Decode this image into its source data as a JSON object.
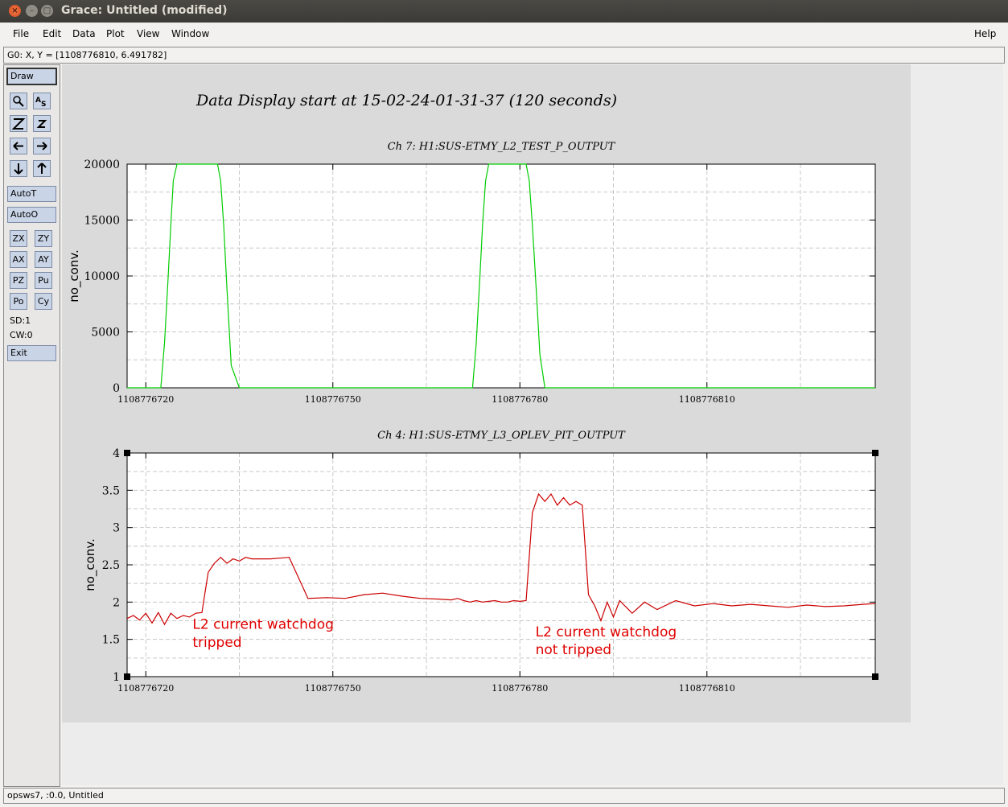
{
  "window": {
    "title": "Grace: Untitled (modified)",
    "close_glyph": "×",
    "min_glyph": "–",
    "max_glyph": "□"
  },
  "menu": {
    "file": "File",
    "edit": "Edit",
    "data": "Data",
    "plot": "Plot",
    "view": "View",
    "window": "Window",
    "help": "Help"
  },
  "locator": "G0: X, Y = [1108776810, 6.491782]",
  "toolbar": {
    "draw": "Draw",
    "autot": "AutoT",
    "autoo": "AutoO",
    "zx": "ZX",
    "zy": "ZY",
    "ax": "AX",
    "ay": "AY",
    "pz": "PZ",
    "pu": "Pu",
    "po": "Po",
    "cy": "Cy",
    "sd": "SD:1",
    "cw": "CW:0",
    "exit": "Exit",
    "icons": [
      "zoom-icon",
      "autoscale-text-icon",
      "zoom-in-icon",
      "zoom-out-icon",
      "left-arrow-icon",
      "right-arrow-icon",
      "down-arrow-icon",
      "up-arrow-icon"
    ]
  },
  "status": "opsws7, :0.0, Untitled",
  "canvas": {
    "main_title": "Data Display start at 15-02-24-01-31-37 (120 seconds)"
  },
  "chart_data": [
    {
      "type": "line",
      "title": "Ch 7: H1:SUS-ETMY_L2_TEST_P_OUTPUT",
      "ylabel": "no_conv.",
      "xlabel": "",
      "xlim": [
        1108776717,
        1108776837
      ],
      "ylim": [
        0,
        20000
      ],
      "xticks": [
        "1108776720",
        "1108776750",
        "1108776780",
        "1108776810"
      ],
      "yticks": [
        "0",
        "5000",
        "10000",
        "15000",
        "20000"
      ],
      "grid": true,
      "series": [
        {
          "color": "#00cc00",
          "x": [
            1108776717,
            1108776722.4,
            1108776723,
            1108776723.6,
            1108776724,
            1108776724.4,
            1108776725,
            1108776731.5,
            1108776732,
            1108776732.5,
            1108776733,
            1108776733.7,
            1108776735,
            1108776767,
            1108776772.4,
            1108776773,
            1108776773.6,
            1108776774,
            1108776774.5,
            1108776775,
            1108776781,
            1108776781.5,
            1108776782,
            1108776782.6,
            1108776783.2,
            1108776784,
            1108776837
          ],
          "y": [
            0,
            0,
            4000,
            10000,
            14500,
            18500,
            20000,
            20000,
            18500,
            14500,
            9000,
            2000,
            0,
            0,
            0,
            4000,
            10000,
            14500,
            18500,
            20000,
            20000,
            18500,
            14500,
            9000,
            3000,
            0,
            0
          ]
        }
      ]
    },
    {
      "type": "line",
      "title": "Ch 4: H1:SUS-ETMY_L3_OPLEV_PIT_OUTPUT",
      "ylabel": "no_conv.",
      "xlabel": "",
      "xlim": [
        1108776717,
        1108776837
      ],
      "ylim": [
        1,
        4
      ],
      "xticks": [
        "1108776720",
        "1108776750",
        "1108776780",
        "1108776810"
      ],
      "yticks": [
        "1",
        "1.5",
        "2",
        "2.5",
        "3",
        "3.5",
        "4"
      ],
      "grid": true,
      "annotations": [
        {
          "text": "L2 current watchdog",
          "x": 1108776727.5,
          "y": 1.64
        },
        {
          "text": "tripped",
          "x": 1108776727.5,
          "y": 1.4
        },
        {
          "text": "L2 current watchdog",
          "x": 1108776782.5,
          "y": 1.54
        },
        {
          "text": "not tripped",
          "x": 1108776782.5,
          "y": 1.3
        }
      ],
      "series": [
        {
          "color": "#cc0000",
          "x": [
            1108776717,
            1108776718,
            1108776719,
            1108776720,
            1108776721,
            1108776722,
            1108776723,
            1108776724,
            1108776725,
            1108776726,
            1108776727,
            1108776728,
            1108776729,
            1108776730,
            1108776731,
            1108776732,
            1108776733,
            1108776734,
            1108776735,
            1108776736,
            1108776737,
            1108776740,
            1108776743,
            1108776746,
            1108776749,
            1108776752,
            1108776755,
            1108776758,
            1108776761,
            1108776764,
            1108776767,
            1108776769,
            1108776770,
            1108776771,
            1108776772,
            1108776773,
            1108776774,
            1108776775,
            1108776776,
            1108776777,
            1108776778,
            1108776779,
            1108776780,
            1108776781,
            1108776782,
            1108776783,
            1108776784,
            1108776785,
            1108776786,
            1108776787,
            1108776788,
            1108776789,
            1108776790,
            1108776791,
            1108776792,
            1108776793,
            1108776794,
            1108776795,
            1108776796,
            1108776798,
            1108776800,
            1108776802,
            1108776805,
            1108776808,
            1108776811,
            1108776814,
            1108776817,
            1108776820,
            1108776823,
            1108776826,
            1108776829,
            1108776832,
            1108776835,
            1108776837
          ],
          "y": [
            1.78,
            1.82,
            1.76,
            1.85,
            1.72,
            1.86,
            1.7,
            1.85,
            1.78,
            1.82,
            1.8,
            1.85,
            1.86,
            2.4,
            2.52,
            2.6,
            2.52,
            2.58,
            2.55,
            2.6,
            2.58,
            2.58,
            2.6,
            2.05,
            2.06,
            2.05,
            2.1,
            2.12,
            2.08,
            2.05,
            2.04,
            2.03,
            2.05,
            2.02,
            2.0,
            2.02,
            2.0,
            2.01,
            2.02,
            2.0,
            2.0,
            2.02,
            2.01,
            2.02,
            3.2,
            3.45,
            3.35,
            3.45,
            3.3,
            3.4,
            3.3,
            3.35,
            3.3,
            2.1,
            1.95,
            1.75,
            2.0,
            1.8,
            2.02,
            1.85,
            2.0,
            1.9,
            2.02,
            1.95,
            1.98,
            1.95,
            1.97,
            1.95,
            1.93,
            1.96,
            1.94,
            1.95,
            1.97,
            1.98
          ]
        }
      ]
    }
  ]
}
